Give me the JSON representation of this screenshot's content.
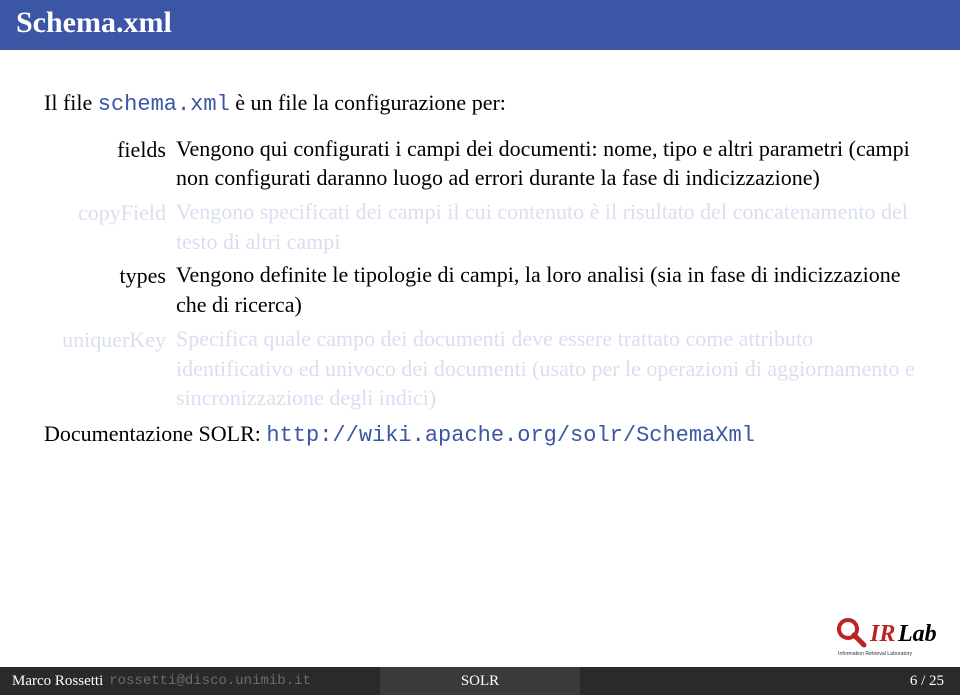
{
  "header": {
    "title": "Schema.xml"
  },
  "intro": {
    "prefix": "Il file ",
    "filename": "schema.xml",
    "suffix": " è un file la configurazione per:"
  },
  "defs": [
    {
      "term": "fields",
      "faded": false,
      "desc": "Vengono qui configurati i campi dei documenti: nome, tipo e altri parametri (campi non configurati daranno luogo ad errori durante la fase di indicizzazione)"
    },
    {
      "term": "copyField",
      "faded": true,
      "desc": "Vengono specificati dei campi il cui contenuto è il risultato del concatenamento del testo di altri campi"
    },
    {
      "term": "types",
      "faded": false,
      "desc": "Vengono definite le tipologie di campi, la loro analisi (sia in fase di indicizzazione che di ricerca)"
    },
    {
      "term": "uniquerKey",
      "faded": true,
      "desc": "Specifica quale campo dei documenti deve essere trattato come attributo identificativo ed univoco dei documenti (usato per le operazioni di aggiornamento e sincronizzazione degli indici)"
    }
  ],
  "doclink": {
    "label": "Documentazione SOLR: ",
    "url": "http://wiki.apache.org/solr/SchemaXml"
  },
  "footer": {
    "author": "Marco Rossetti",
    "email": "rossetti@disco.unimib.it",
    "center": "SOLR",
    "page": "6 / 25"
  },
  "logo": {
    "text_ir": "IR",
    "text_lab": "Lab",
    "subtitle": "Information Retrieval Laboratory"
  }
}
